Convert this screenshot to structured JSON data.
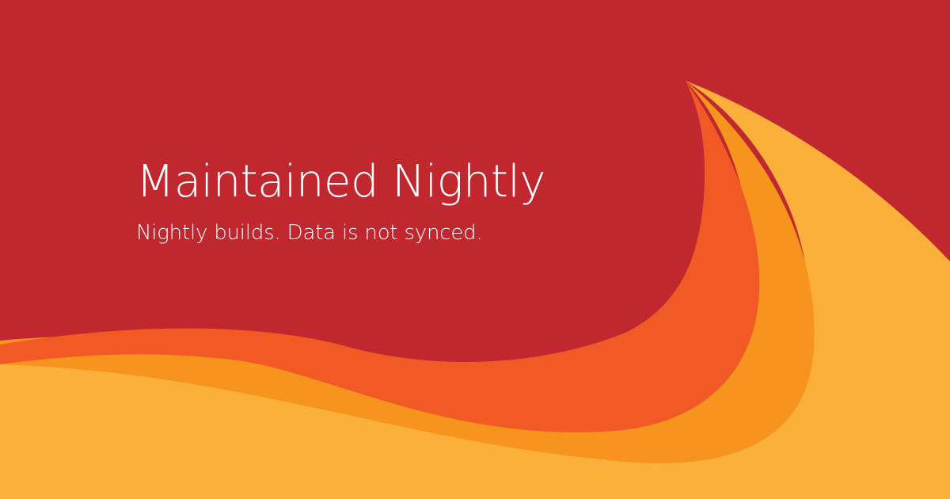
{
  "hero": {
    "title": "Maintained Nightly",
    "subtitle": "Nightly builds. Data is not synced."
  },
  "colors": {
    "background": "#c1272f",
    "wave_light": "#fbb03b",
    "wave_mid": "#f7941d",
    "wave_dark": "#f15a24",
    "text": "#ffffff"
  }
}
